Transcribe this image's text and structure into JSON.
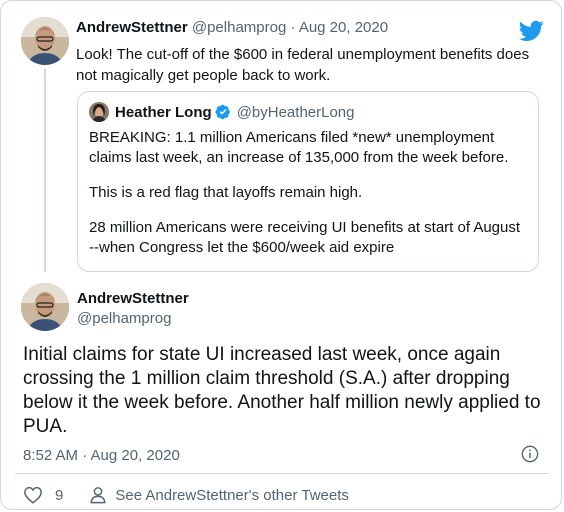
{
  "reply_tweet": {
    "author_name": "AndrewStettner",
    "author_handle": "@pelhamprog",
    "separator": "·",
    "date": "Aug 20, 2020",
    "text": "Look! The cut-off of the $600 in federal unemployment benefits does not magically get people back to work."
  },
  "quoted_tweet": {
    "author_name": "Heather Long",
    "author_handle": "@byHeatherLong",
    "paragraphs": [
      "BREAKING: 1.1 million Americans filed *new* unemployment claims last week, an increase of 135,000  from the week before.",
      "This is a red flag that layoffs remain high.",
      "28 million Americans were receiving UI benefits at start of August --when Congress let the $600/week aid expire"
    ]
  },
  "main_tweet": {
    "author_name": "AndrewStettner",
    "author_handle": "@pelhamprog",
    "text": "Initial claims for state UI increased last week, once again crossing the 1 million claim threshold (S.A.) after dropping below it the week before. Another half million newly applied to PUA.",
    "timestamp": "8:52 AM · Aug 20, 2020",
    "like_count": "9",
    "see_more_label": "See AndrewStettner's other Tweets"
  },
  "icons": {
    "brand": "twitter-bird-icon",
    "verified": "verified-badge-icon",
    "info": "info-icon",
    "like": "heart-icon",
    "profile": "person-icon"
  },
  "colors": {
    "brand": "#1d9bf0",
    "text": "#0f1419",
    "secondary": "#536471",
    "border": "#cfd9de"
  }
}
